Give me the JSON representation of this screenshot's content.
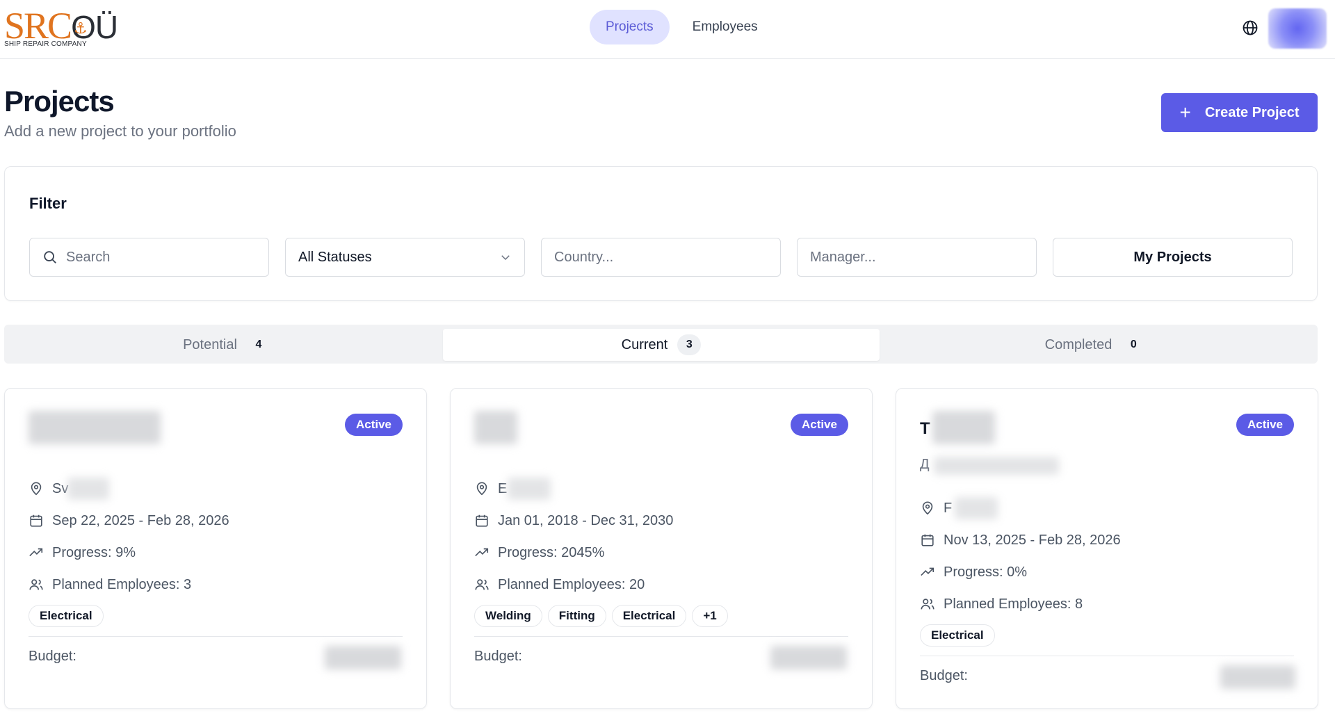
{
  "header": {
    "logo": {
      "main": "SRC",
      "suffix": "OÜ",
      "tagline": "SHIP REPAIR COMPANY"
    },
    "nav": [
      {
        "label": "Projects",
        "active": true
      },
      {
        "label": "Employees",
        "active": false
      }
    ],
    "icons": {
      "language": "globe-icon",
      "avatar": "avatar"
    }
  },
  "page": {
    "title": "Projects",
    "subtitle": "Add a new project to your portfolio",
    "create_button": "Create Project"
  },
  "filter": {
    "title": "Filter",
    "search_placeholder": "Search",
    "status_value": "All Statuses",
    "country_placeholder": "Country...",
    "manager_placeholder": "Manager...",
    "my_projects_label": "My Projects"
  },
  "tabs": [
    {
      "label": "Potential",
      "count": "4",
      "active": false
    },
    {
      "label": "Current",
      "count": "3",
      "active": true
    },
    {
      "label": "Completed",
      "count": "0",
      "active": false
    }
  ],
  "cards": [
    {
      "title": "",
      "subtitle": "",
      "status": "Active",
      "location": "Sv",
      "dates": "Sep 22, 2025 - Feb 28, 2026",
      "progress": "Progress: 9%",
      "employees": "Planned Employees: 3",
      "tags": [
        "Electrical"
      ],
      "budget_label": "Budget:"
    },
    {
      "title": "",
      "subtitle": "",
      "status": "Active",
      "location": "E",
      "dates": "Jan 01, 2018 - Dec 31, 2030",
      "progress": "Progress: 2045%",
      "employees": "Planned Employees: 20",
      "tags": [
        "Welding",
        "Fitting",
        "Electrical",
        "+1"
      ],
      "budget_label": "Budget:"
    },
    {
      "title": "T",
      "subtitle": "Д",
      "status": "Active",
      "location": "F",
      "dates": "Nov 13, 2025 - Feb 28, 2026",
      "progress": "Progress: 0%",
      "employees": "Planned Employees: 8",
      "tags": [
        "Electrical"
      ],
      "budget_label": "Budget:"
    }
  ],
  "colors": {
    "accent": "#5b5be6",
    "logo_orange": "#e0741f",
    "nav_active_bg": "#e0e2ff"
  }
}
